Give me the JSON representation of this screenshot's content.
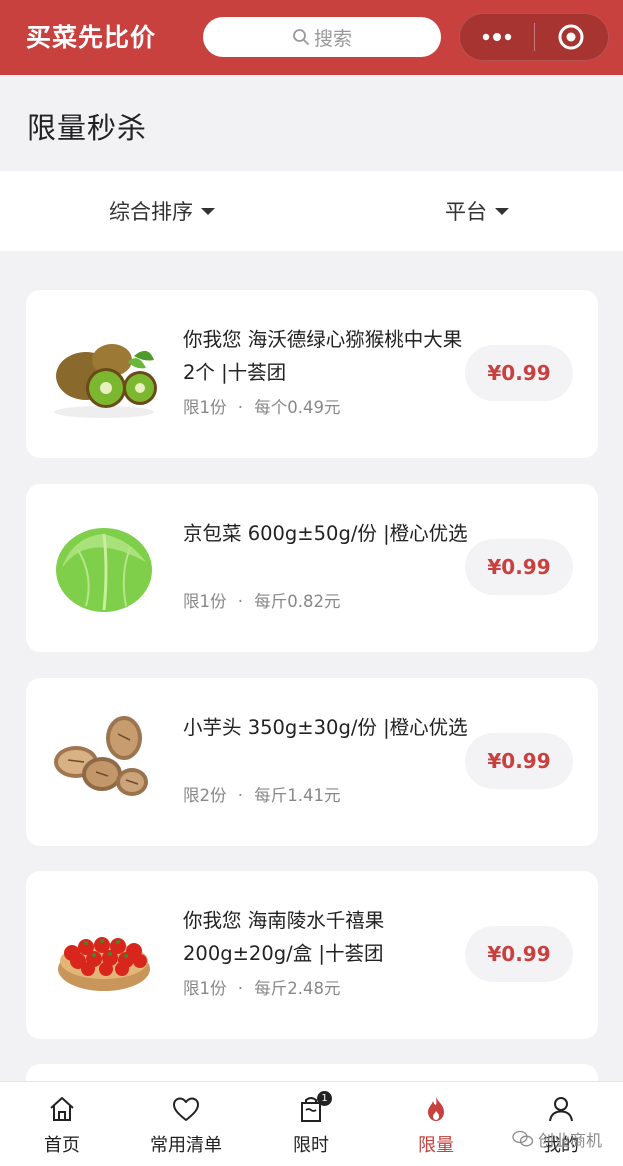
{
  "header": {
    "app_title": "买菜先比价",
    "search_placeholder": "搜索",
    "colors": {
      "brand": "#c8413f"
    }
  },
  "page": {
    "title": "限量秒杀"
  },
  "filters": [
    {
      "label": "综合排序"
    },
    {
      "label": "平台"
    }
  ],
  "products": [
    {
      "name": "你我您 海沃德绿心猕猴桃中大果 2个 |十荟团",
      "limit": "限1份",
      "unit_price": "每个0.49元",
      "price": "¥0.99",
      "image": "kiwi"
    },
    {
      "name": "京包菜 600g±50g/份 |橙心优选",
      "limit": "限1份",
      "unit_price": "每斤0.82元",
      "price": "¥0.99",
      "image": "cabbage"
    },
    {
      "name": "小芋头 350g±30g/份 |橙心优选",
      "limit": "限2份",
      "unit_price": "每斤1.41元",
      "price": "¥0.99",
      "image": "taro"
    },
    {
      "name": "你我您 海南陵水千禧果 200g±20g/盒 |十荟团",
      "limit": "限1份",
      "unit_price": "每斤2.48元",
      "price": "¥0.99",
      "image": "cherry-tomato"
    }
  ],
  "meta_separator": "·",
  "tabbar": {
    "items": [
      {
        "label": "首页",
        "icon": "home-icon"
      },
      {
        "label": "常用清单",
        "icon": "heart-icon"
      },
      {
        "label": "限时",
        "icon": "timer-bag-icon",
        "badge": "1"
      },
      {
        "label": "限量",
        "icon": "flame-icon",
        "active": true
      },
      {
        "label": "我的",
        "icon": "user-icon"
      }
    ]
  },
  "watermark": "创业商机"
}
